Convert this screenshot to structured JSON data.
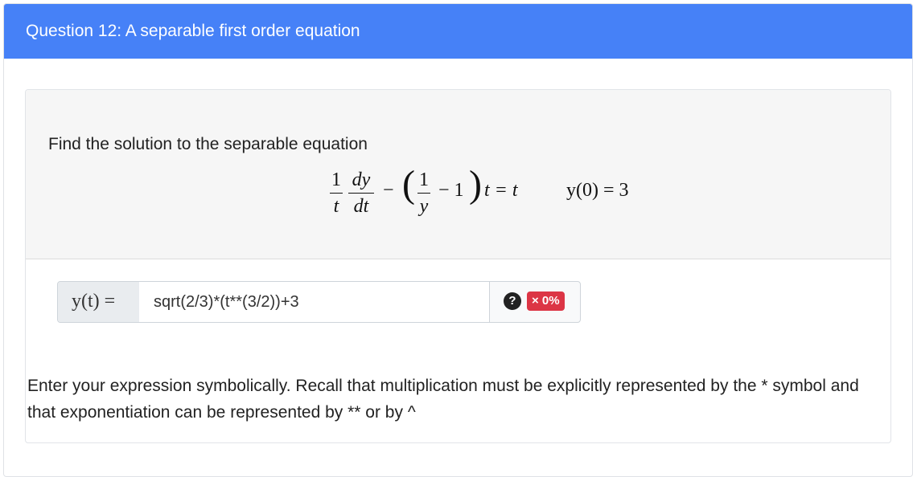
{
  "header": {
    "title": "Question 12: A separable first order equation"
  },
  "question": {
    "prompt": "Find the solution to the separable equation",
    "equation": {
      "frac1_num": "1",
      "frac1_den": "t",
      "frac2_num": "dy",
      "frac2_den": "dt",
      "minus": "−",
      "frac3_num": "1",
      "frac3_den": "y",
      "inner_rest": "− 1",
      "tail": "t = t",
      "initial_condition": "y(0) = 3"
    }
  },
  "answer": {
    "label": "y(t) =",
    "value": "sqrt(2/3)*(t**(3/2))+3",
    "help_symbol": "?",
    "score_badge": "× 0%"
  },
  "instructions": "Enter your expression symbolically. Recall that multiplication must be explicitly represented by the * symbol and that exponentiation can be represented by ** or by ^",
  "colors": {
    "header_bg": "#4681f7",
    "score_badge_bg": "#dc3545",
    "question_body_bg": "#f6f6f6"
  },
  "icons": [
    "help-icon",
    "cross-icon"
  ]
}
